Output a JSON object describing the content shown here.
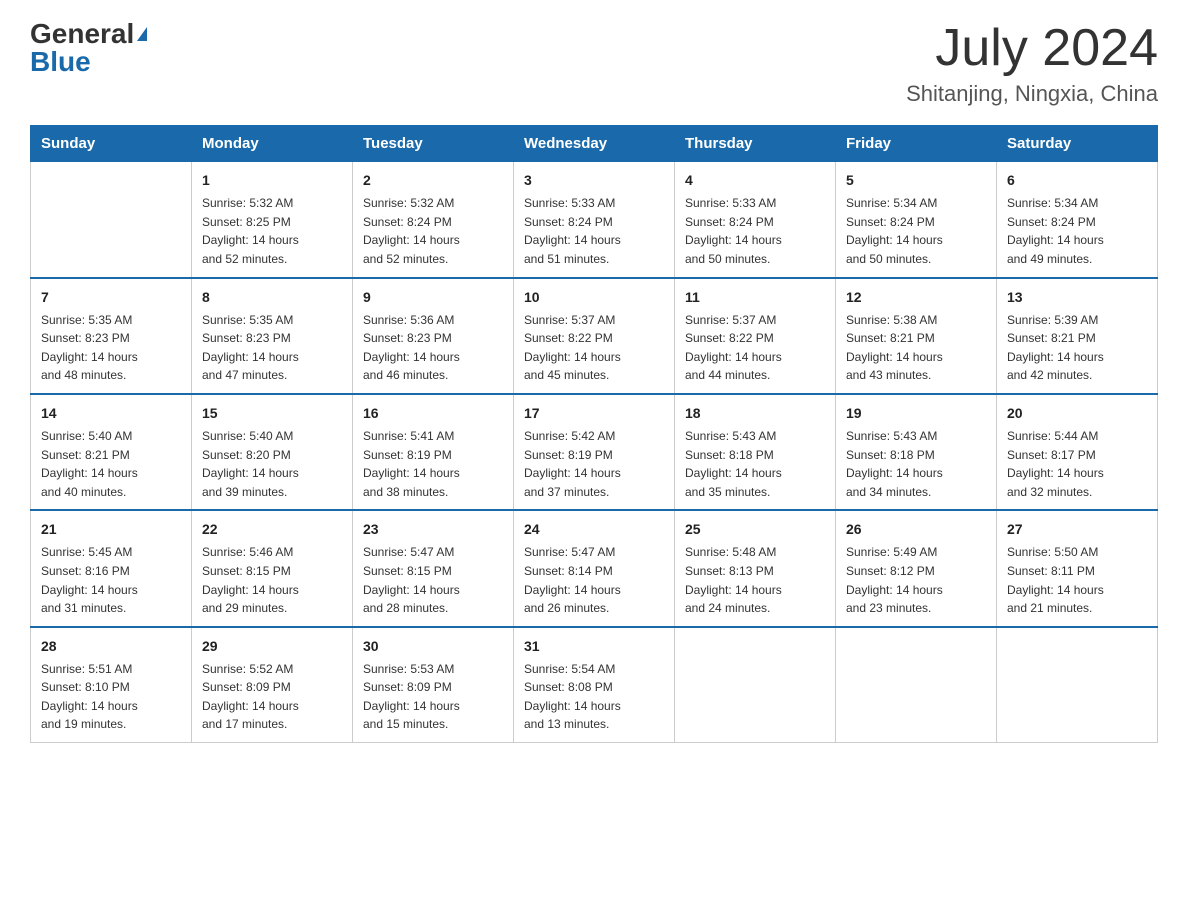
{
  "header": {
    "logo_general": "General",
    "logo_blue": "Blue",
    "month_title": "July 2024",
    "location": "Shitanjing, Ningxia, China"
  },
  "calendar": {
    "days_of_week": [
      "Sunday",
      "Monday",
      "Tuesday",
      "Wednesday",
      "Thursday",
      "Friday",
      "Saturday"
    ],
    "weeks": [
      [
        {
          "day": "",
          "info": ""
        },
        {
          "day": "1",
          "info": "Sunrise: 5:32 AM\nSunset: 8:25 PM\nDaylight: 14 hours\nand 52 minutes."
        },
        {
          "day": "2",
          "info": "Sunrise: 5:32 AM\nSunset: 8:24 PM\nDaylight: 14 hours\nand 52 minutes."
        },
        {
          "day": "3",
          "info": "Sunrise: 5:33 AM\nSunset: 8:24 PM\nDaylight: 14 hours\nand 51 minutes."
        },
        {
          "day": "4",
          "info": "Sunrise: 5:33 AM\nSunset: 8:24 PM\nDaylight: 14 hours\nand 50 minutes."
        },
        {
          "day": "5",
          "info": "Sunrise: 5:34 AM\nSunset: 8:24 PM\nDaylight: 14 hours\nand 50 minutes."
        },
        {
          "day": "6",
          "info": "Sunrise: 5:34 AM\nSunset: 8:24 PM\nDaylight: 14 hours\nand 49 minutes."
        }
      ],
      [
        {
          "day": "7",
          "info": "Sunrise: 5:35 AM\nSunset: 8:23 PM\nDaylight: 14 hours\nand 48 minutes."
        },
        {
          "day": "8",
          "info": "Sunrise: 5:35 AM\nSunset: 8:23 PM\nDaylight: 14 hours\nand 47 minutes."
        },
        {
          "day": "9",
          "info": "Sunrise: 5:36 AM\nSunset: 8:23 PM\nDaylight: 14 hours\nand 46 minutes."
        },
        {
          "day": "10",
          "info": "Sunrise: 5:37 AM\nSunset: 8:22 PM\nDaylight: 14 hours\nand 45 minutes."
        },
        {
          "day": "11",
          "info": "Sunrise: 5:37 AM\nSunset: 8:22 PM\nDaylight: 14 hours\nand 44 minutes."
        },
        {
          "day": "12",
          "info": "Sunrise: 5:38 AM\nSunset: 8:21 PM\nDaylight: 14 hours\nand 43 minutes."
        },
        {
          "day": "13",
          "info": "Sunrise: 5:39 AM\nSunset: 8:21 PM\nDaylight: 14 hours\nand 42 minutes."
        }
      ],
      [
        {
          "day": "14",
          "info": "Sunrise: 5:40 AM\nSunset: 8:21 PM\nDaylight: 14 hours\nand 40 minutes."
        },
        {
          "day": "15",
          "info": "Sunrise: 5:40 AM\nSunset: 8:20 PM\nDaylight: 14 hours\nand 39 minutes."
        },
        {
          "day": "16",
          "info": "Sunrise: 5:41 AM\nSunset: 8:19 PM\nDaylight: 14 hours\nand 38 minutes."
        },
        {
          "day": "17",
          "info": "Sunrise: 5:42 AM\nSunset: 8:19 PM\nDaylight: 14 hours\nand 37 minutes."
        },
        {
          "day": "18",
          "info": "Sunrise: 5:43 AM\nSunset: 8:18 PM\nDaylight: 14 hours\nand 35 minutes."
        },
        {
          "day": "19",
          "info": "Sunrise: 5:43 AM\nSunset: 8:18 PM\nDaylight: 14 hours\nand 34 minutes."
        },
        {
          "day": "20",
          "info": "Sunrise: 5:44 AM\nSunset: 8:17 PM\nDaylight: 14 hours\nand 32 minutes."
        }
      ],
      [
        {
          "day": "21",
          "info": "Sunrise: 5:45 AM\nSunset: 8:16 PM\nDaylight: 14 hours\nand 31 minutes."
        },
        {
          "day": "22",
          "info": "Sunrise: 5:46 AM\nSunset: 8:15 PM\nDaylight: 14 hours\nand 29 minutes."
        },
        {
          "day": "23",
          "info": "Sunrise: 5:47 AM\nSunset: 8:15 PM\nDaylight: 14 hours\nand 28 minutes."
        },
        {
          "day": "24",
          "info": "Sunrise: 5:47 AM\nSunset: 8:14 PM\nDaylight: 14 hours\nand 26 minutes."
        },
        {
          "day": "25",
          "info": "Sunrise: 5:48 AM\nSunset: 8:13 PM\nDaylight: 14 hours\nand 24 minutes."
        },
        {
          "day": "26",
          "info": "Sunrise: 5:49 AM\nSunset: 8:12 PM\nDaylight: 14 hours\nand 23 minutes."
        },
        {
          "day": "27",
          "info": "Sunrise: 5:50 AM\nSunset: 8:11 PM\nDaylight: 14 hours\nand 21 minutes."
        }
      ],
      [
        {
          "day": "28",
          "info": "Sunrise: 5:51 AM\nSunset: 8:10 PM\nDaylight: 14 hours\nand 19 minutes."
        },
        {
          "day": "29",
          "info": "Sunrise: 5:52 AM\nSunset: 8:09 PM\nDaylight: 14 hours\nand 17 minutes."
        },
        {
          "day": "30",
          "info": "Sunrise: 5:53 AM\nSunset: 8:09 PM\nDaylight: 14 hours\nand 15 minutes."
        },
        {
          "day": "31",
          "info": "Sunrise: 5:54 AM\nSunset: 8:08 PM\nDaylight: 14 hours\nand 13 minutes."
        },
        {
          "day": "",
          "info": ""
        },
        {
          "day": "",
          "info": ""
        },
        {
          "day": "",
          "info": ""
        }
      ]
    ]
  }
}
